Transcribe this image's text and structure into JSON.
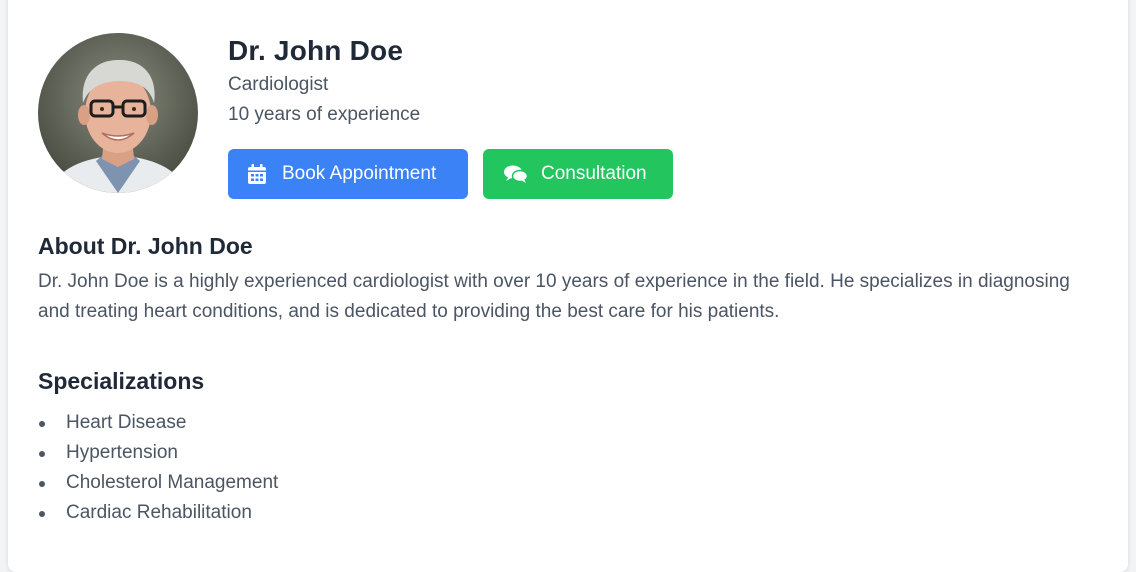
{
  "profile": {
    "name": "Dr. John Doe",
    "specialty": "Cardiologist",
    "experience": "10 years of experience",
    "avatar_alt": "doctor-portrait"
  },
  "actions": {
    "book_label": "Book Appointment",
    "book_icon": "calendar-icon",
    "consult_label": "Consultation",
    "consult_icon": "chat-bubbles-icon"
  },
  "about": {
    "title": "About Dr. John Doe",
    "text": "Dr. John Doe is a highly experienced cardiologist with over 10 years of experience in the field. He specializes in diagnosing and treating heart conditions, and is dedicated to providing the best care for his patients."
  },
  "specializations": {
    "title": "Specializations",
    "items": [
      "Heart Disease",
      "Hypertension",
      "Cholesterol Management",
      "Cardiac Rehabilitation"
    ]
  },
  "colors": {
    "primary": "#3b82f6",
    "success": "#22c55e",
    "heading": "#1f2937",
    "body": "#4b5563"
  }
}
